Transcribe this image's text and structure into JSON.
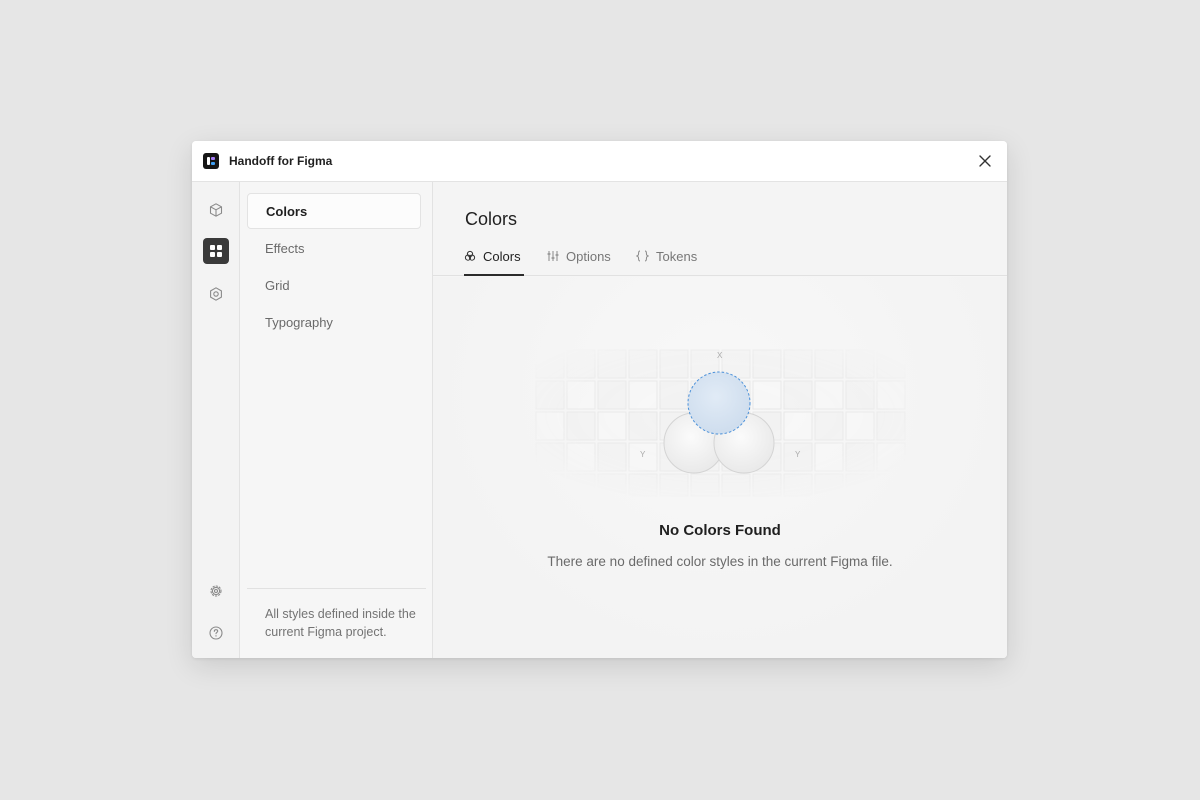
{
  "window": {
    "title": "Handoff for Figma",
    "icons": {
      "logo": "handoff-logo-icon",
      "close": "close-icon"
    }
  },
  "rail": {
    "items": [
      {
        "icon": "cube-icon",
        "active": false
      },
      {
        "icon": "grid-icon",
        "active": true
      },
      {
        "icon": "hexagon-icon",
        "active": false
      },
      {
        "icon": "settings-gear-icon",
        "active": false
      },
      {
        "icon": "help-circle-icon",
        "active": false
      }
    ]
  },
  "sidebar": {
    "items": [
      {
        "label": "Colors",
        "active": true
      },
      {
        "label": "Effects",
        "active": false
      },
      {
        "label": "Grid",
        "active": false
      },
      {
        "label": "Typography",
        "active": false
      }
    ],
    "note": "All styles defined inside the current Figma project."
  },
  "main": {
    "title": "Colors",
    "tabs": [
      {
        "label": "Colors",
        "icon": "palette-icon",
        "active": true
      },
      {
        "label": "Options",
        "icon": "sliders-icon",
        "active": false
      },
      {
        "label": "Tokens",
        "icon": "braces-icon",
        "active": false
      }
    ],
    "illustration": {
      "axis_x": "X",
      "axis_y_left": "Y",
      "axis_y_right": "Y"
    },
    "empty": {
      "title": "No Colors Found",
      "description": "There are no defined color styles in the current Figma file."
    }
  },
  "colors": {
    "accent_dark": "#3a3a3a",
    "selection_blue": "#4a90d9",
    "selection_fill": "#d7e4f3"
  }
}
